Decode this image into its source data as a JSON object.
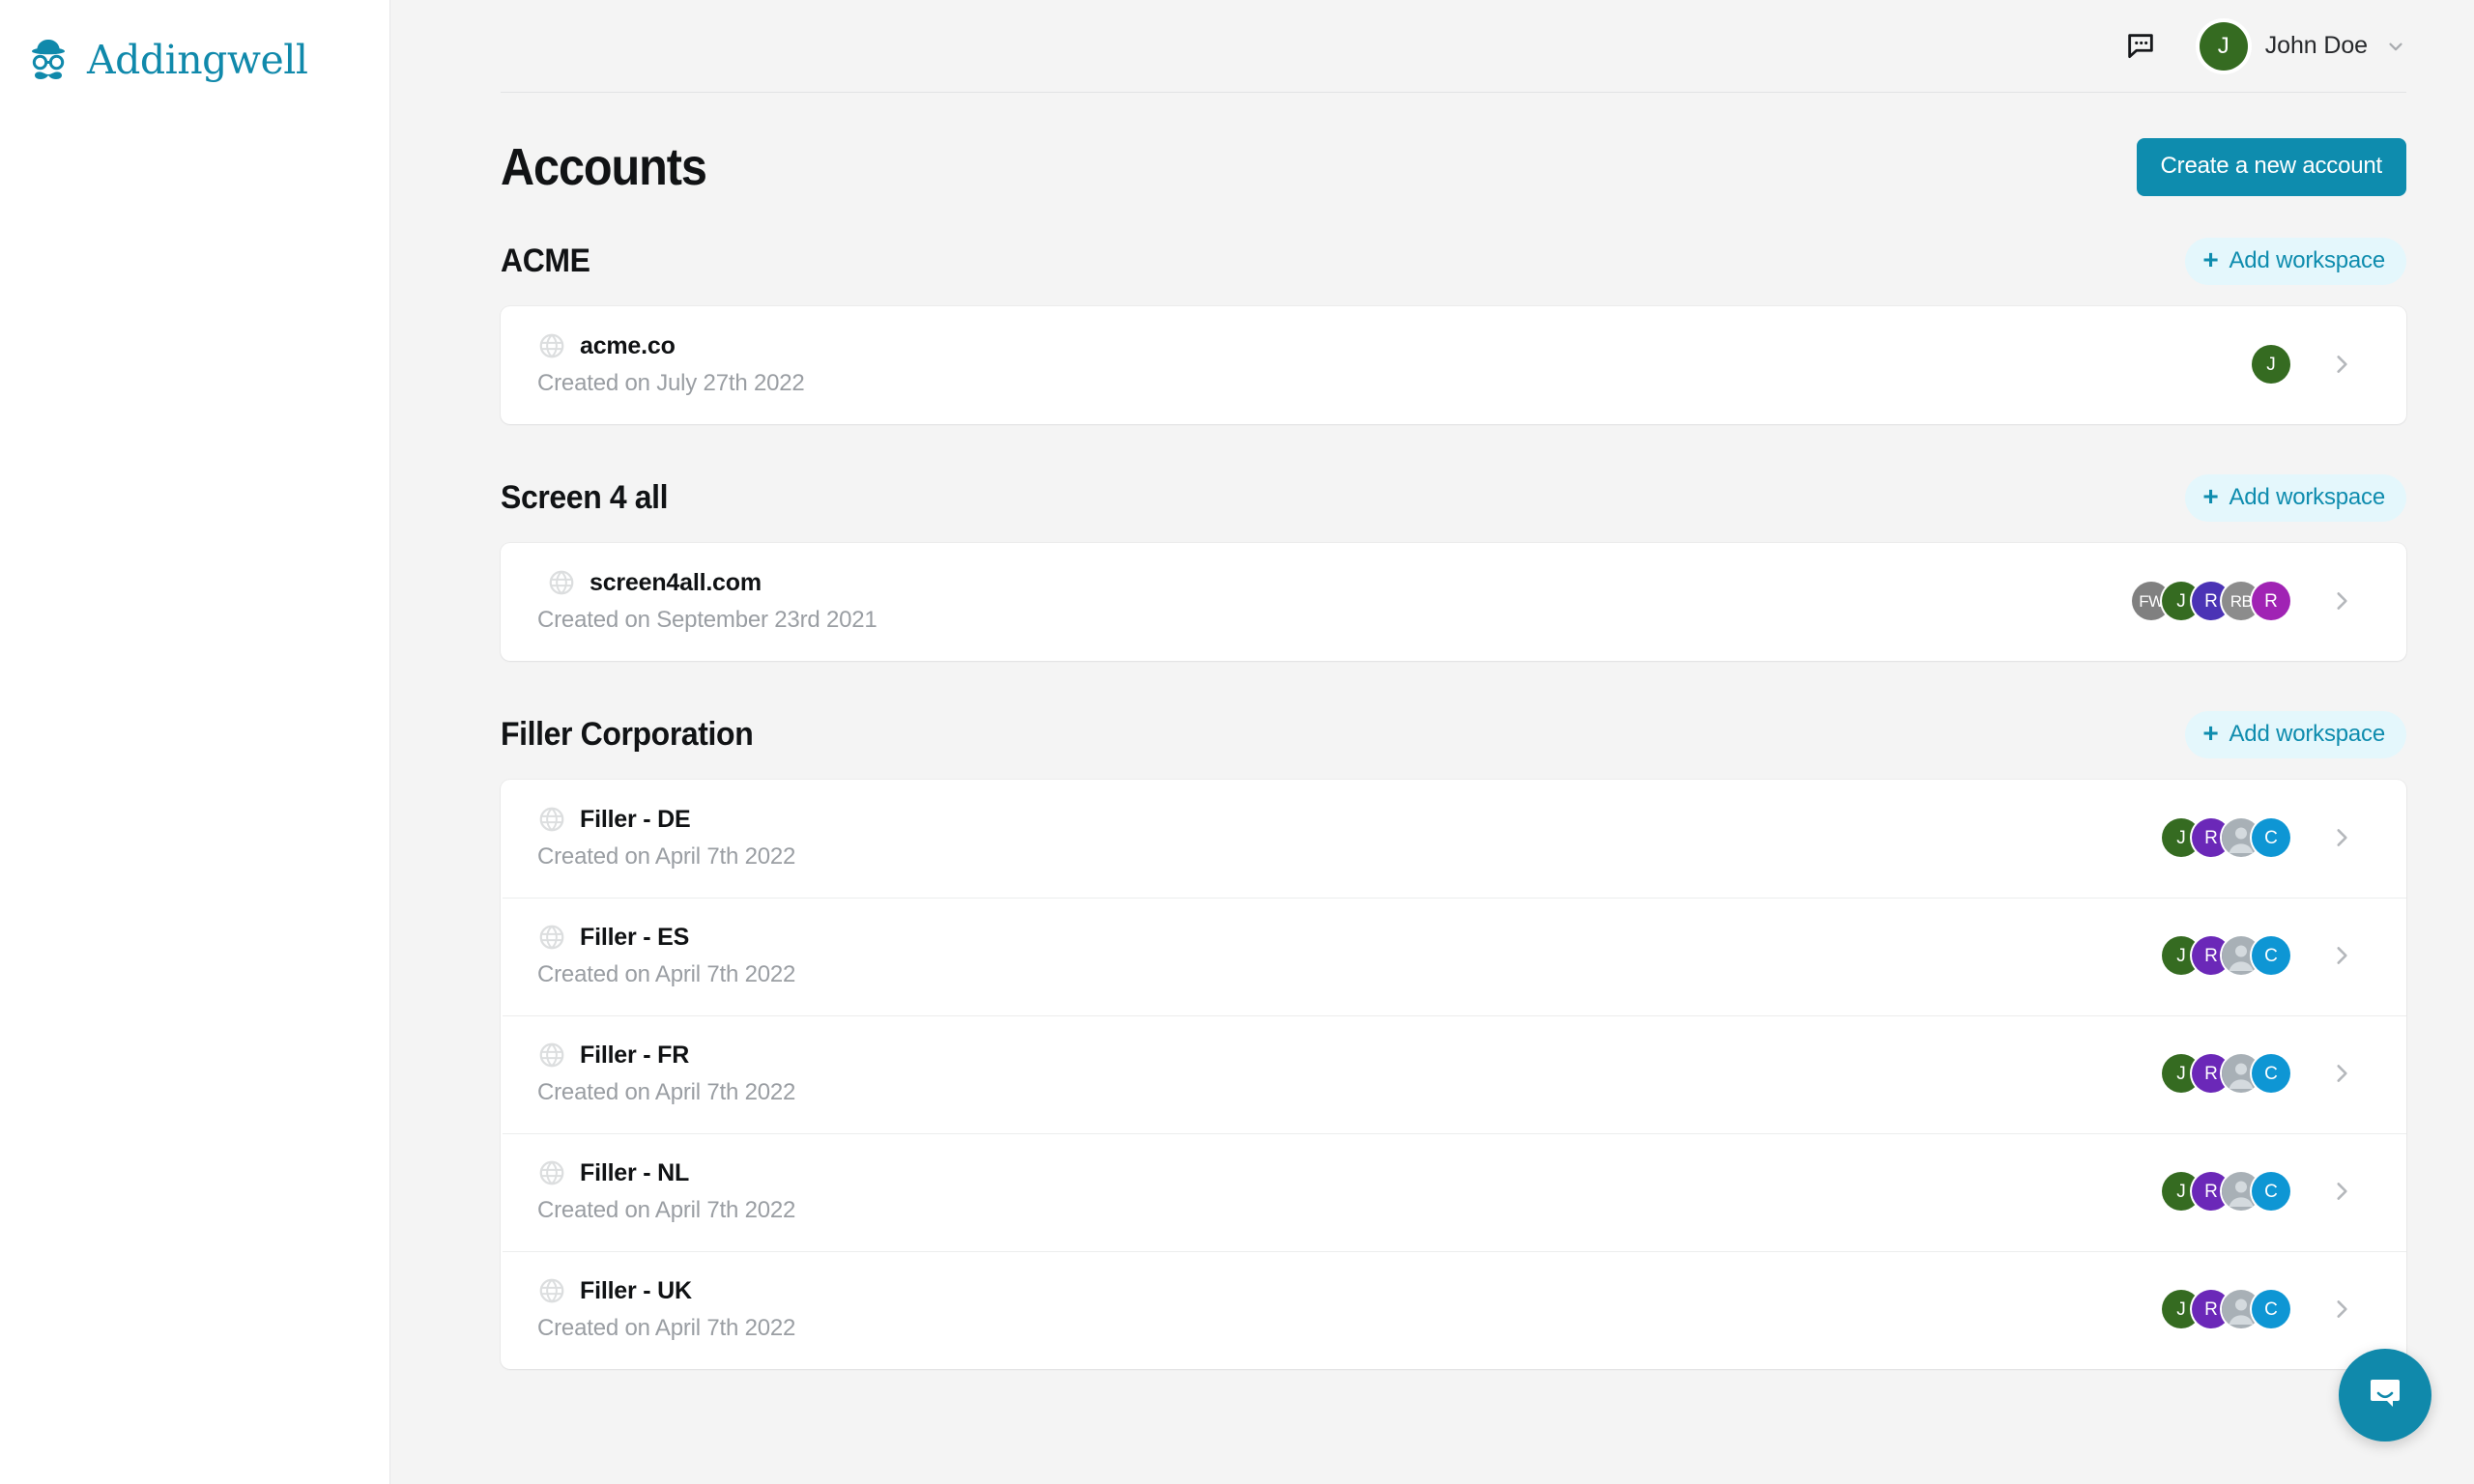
{
  "brand": {
    "name": "Addingwell",
    "color": "#1089ab",
    "logo_icon": "mustache-hat-glasses-icon"
  },
  "topbar": {
    "chat_icon": "chat-bubble-icon",
    "user": {
      "initial": "J",
      "name": "John Doe",
      "avatar_color": "#356b21",
      "chevron_icon": "chevron-down-icon"
    }
  },
  "page": {
    "title": "Accounts",
    "create_button": "Create a new account",
    "create_button_color": "#0e8cae"
  },
  "add_workspace_label": "Add workspace",
  "add_workspace_plus": "+",
  "groups": [
    {
      "name": "ACME",
      "workspaces": [
        {
          "name": "acme.co",
          "created": "Created on July 27th 2022",
          "icon": "globe-icon",
          "indented": false,
          "members": [
            {
              "initials": "J",
              "color": "#356b21",
              "type": "initials"
            }
          ]
        }
      ]
    },
    {
      "name": "Screen 4 all",
      "workspaces": [
        {
          "name": "screen4all.com",
          "created": "Created on September 23rd 2021",
          "icon": "globe-icon",
          "indented": true,
          "members": [
            {
              "initials": "FW",
              "color": "#808080",
              "type": "initials"
            },
            {
              "initials": "J",
              "color": "#356b21",
              "type": "initials"
            },
            {
              "initials": "R",
              "color": "#4b33b5",
              "type": "initials"
            },
            {
              "initials": "RB",
              "color": "#8c8c8c",
              "type": "initials"
            },
            {
              "initials": "R",
              "color": "#a023b4",
              "type": "initials"
            }
          ]
        }
      ]
    },
    {
      "name": "Filler Corporation",
      "workspaces": [
        {
          "name": "Filler - DE",
          "created": "Created on April 7th 2022",
          "icon": "globe-icon",
          "indented": false,
          "members": [
            {
              "initials": "J",
              "color": "#356b21",
              "type": "initials"
            },
            {
              "initials": "R",
              "color": "#6b28b8",
              "type": "initials"
            },
            {
              "initials": "",
              "color": "#a8b0b6",
              "type": "person-placeholder"
            },
            {
              "initials": "C",
              "color": "#0e96d4",
              "type": "initials"
            }
          ]
        },
        {
          "name": "Filler - ES",
          "created": "Created on April 7th 2022",
          "icon": "globe-icon",
          "indented": false,
          "members": [
            {
              "initials": "J",
              "color": "#356b21",
              "type": "initials"
            },
            {
              "initials": "R",
              "color": "#6b28b8",
              "type": "initials"
            },
            {
              "initials": "",
              "color": "#a8b0b6",
              "type": "person-placeholder"
            },
            {
              "initials": "C",
              "color": "#0e96d4",
              "type": "initials"
            }
          ]
        },
        {
          "name": "Filler - FR",
          "created": "Created on April 7th 2022",
          "icon": "globe-icon",
          "indented": false,
          "members": [
            {
              "initials": "J",
              "color": "#356b21",
              "type": "initials"
            },
            {
              "initials": "R",
              "color": "#6b28b8",
              "type": "initials"
            },
            {
              "initials": "",
              "color": "#a8b0b6",
              "type": "person-placeholder"
            },
            {
              "initials": "C",
              "color": "#0e96d4",
              "type": "initials"
            }
          ]
        },
        {
          "name": "Filler - NL",
          "created": "Created on April 7th 2022",
          "icon": "globe-icon",
          "indented": false,
          "members": [
            {
              "initials": "J",
              "color": "#356b21",
              "type": "initials"
            },
            {
              "initials": "R",
              "color": "#6b28b8",
              "type": "initials"
            },
            {
              "initials": "",
              "color": "#a8b0b6",
              "type": "person-placeholder"
            },
            {
              "initials": "C",
              "color": "#0e96d4",
              "type": "initials"
            }
          ]
        },
        {
          "name": "Filler - UK",
          "created": "Created on April 7th 2022",
          "icon": "globe-icon",
          "indented": false,
          "members": [
            {
              "initials": "J",
              "color": "#356b21",
              "type": "initials"
            },
            {
              "initials": "R",
              "color": "#6b28b8",
              "type": "initials"
            },
            {
              "initials": "",
              "color": "#a8b0b6",
              "type": "person-placeholder"
            },
            {
              "initials": "C",
              "color": "#0e96d4",
              "type": "initials"
            }
          ]
        }
      ]
    }
  ],
  "intercom": {
    "icon": "intercom-chat-icon",
    "color": "#1089ab"
  }
}
